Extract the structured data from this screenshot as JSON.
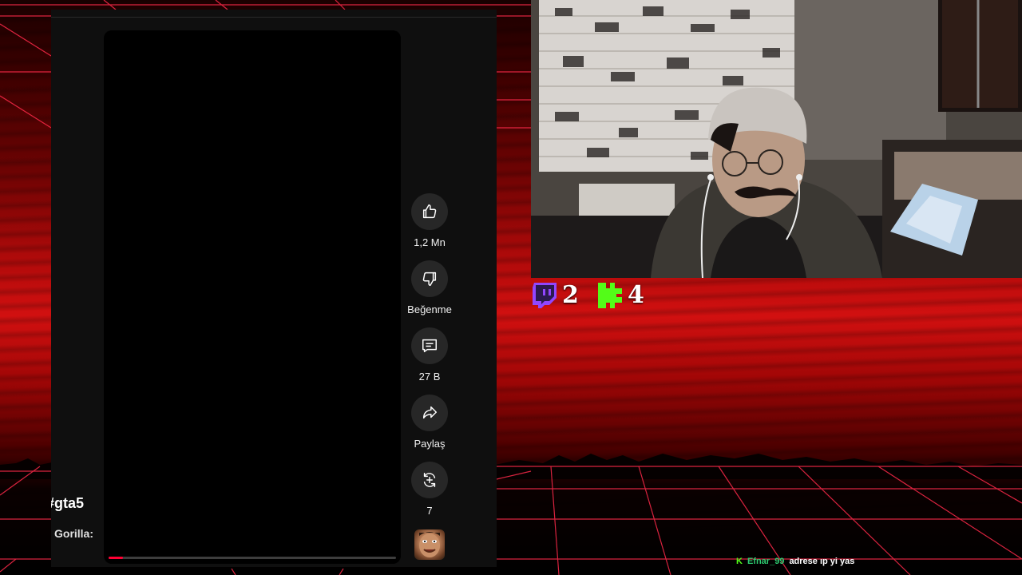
{
  "video_actions": {
    "like_count": "1,2 Mn",
    "dislike_label": "Beğenme",
    "comments_count": "27 B",
    "share_label": "Paylaş",
    "remix_count": "7"
  },
  "video_progress": 0.05,
  "overlay_text": {
    "hashtag": "#gta5",
    "channel_partial": "Gorilla:"
  },
  "platform_counters": {
    "twitch_viewers": "2",
    "kick_viewers": "4"
  },
  "chat": {
    "platform_icon": "kick-icon",
    "username": "Efnar_99",
    "message": "adrese ıp yi yas"
  },
  "colors": {
    "accent_red": "#ff0033",
    "twitch_purple": "#9146ff",
    "kick_green": "#53fc18"
  }
}
